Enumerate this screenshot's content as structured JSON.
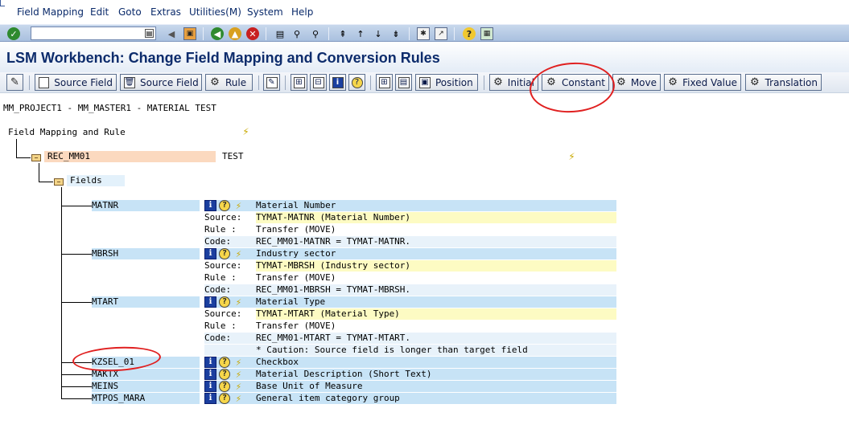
{
  "menu": [
    "Field Mapping",
    "Edit",
    "Goto",
    "Extras",
    "Utilities(M)",
    "System",
    "Help"
  ],
  "title": "LSM Workbench: Change Field Mapping and Conversion Rules",
  "app_toolbar": {
    "source_field_1": "Source Field",
    "source_field_2": "Source Field",
    "rule": "Rule",
    "position": "Position",
    "initial": "Initial",
    "constant": "Constant",
    "move": "Move",
    "fixed_value": "Fixed Value",
    "translation": "Translation"
  },
  "project_line": "MM_PROJECT1 - MM_MASTER1 - MATERIAL TEST",
  "tree": {
    "root_label": "Field Mapping and Rule",
    "structure": {
      "name": "REC_MM01",
      "desc": "TEST"
    },
    "fields_label": "Fields",
    "fields": [
      {
        "name": "MATNR",
        "description": "Material Number",
        "source_label": "Source:",
        "source": "TYMAT-MATNR (Material Number)",
        "rule_label": "Rule :",
        "rule": "Transfer (MOVE)",
        "code_label": "Code:",
        "code": "REC_MM01-MATNR = TYMAT-MATNR."
      },
      {
        "name": "MBRSH",
        "description": "Industry sector",
        "source_label": "Source:",
        "source": "TYMAT-MBRSH (Industry sector)",
        "rule_label": "Rule :",
        "rule": "Transfer (MOVE)",
        "code_label": "Code:",
        "code": "REC_MM01-MBRSH = TYMAT-MBRSH."
      },
      {
        "name": "MTART",
        "description": "Material Type",
        "source_label": "Source:",
        "source": "TYMAT-MTART (Material Type)",
        "rule_label": "Rule :",
        "rule": "Transfer (MOVE)",
        "code_label": "Code:",
        "code": "REC_MM01-MTART = TYMAT-MTART.",
        "note": "* Caution: Source field is longer than target field"
      },
      {
        "name": "KZSEL_01",
        "description": "Checkbox"
      },
      {
        "name": "MAKTX",
        "description": "Material Description (Short Text)"
      },
      {
        "name": "MEINS",
        "description": "Base Unit of Measure"
      },
      {
        "name": "MTPOS_MARA",
        "description": "General item category group"
      }
    ]
  },
  "colors": {
    "title": "#0d2c6c",
    "field_bg": "#c7e3f6",
    "source_bg": "#fdfbc3",
    "structure_bg": "#fbd9bf",
    "annotation_red": "#e02020"
  },
  "icons": [
    "enter-icon",
    "save-icon",
    "back-icon",
    "exit-icon",
    "cancel-icon",
    "print-icon",
    "find-icon",
    "find-next-icon",
    "first-page-icon",
    "prev-page-icon",
    "next-page-icon",
    "last-page-icon",
    "new-session-icon",
    "shortcut-icon",
    "help-icon",
    "layout-icon",
    "info-icon",
    "wand-icon",
    "folder-icon"
  ]
}
